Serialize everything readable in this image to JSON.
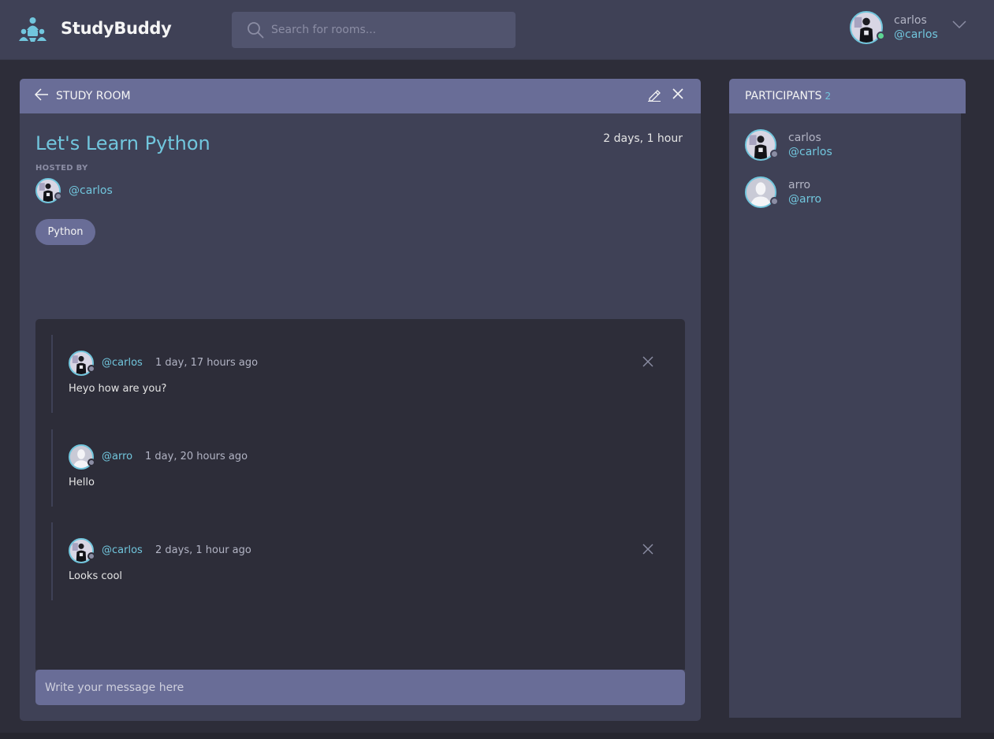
{
  "app": {
    "name": "StudyBuddy"
  },
  "search": {
    "placeholder": "Search for rooms..."
  },
  "current_user": {
    "name": "carlos",
    "handle": "@carlos",
    "status": "online"
  },
  "room": {
    "header_label": "STUDY ROOM",
    "title": "Let's Learn Python",
    "created_ago": "2 days, 1 hour",
    "hosted_by_label": "HOSTED BY",
    "host_handle": "@carlos",
    "topic": "Python"
  },
  "messages": [
    {
      "handle": "@carlos",
      "time": "1 day, 17 hours ago",
      "body": "Heyo how are you?",
      "deletable": true
    },
    {
      "handle": "@arro",
      "time": "1 day, 20 hours ago",
      "body": "Hello",
      "deletable": false
    },
    {
      "handle": "@carlos",
      "time": "2 days, 1 hour ago",
      "body": "Looks cool",
      "deletable": true
    }
  ],
  "message_form": {
    "placeholder": "Write your message here"
  },
  "participants": {
    "label": "PARTICIPANTS",
    "count": "2",
    "items": [
      {
        "name": "carlos",
        "handle": "@carlos"
      },
      {
        "name": "arro",
        "handle": "@arro"
      }
    ]
  },
  "colors": {
    "accent": "#71c6dd",
    "header_bar": "#696d97",
    "panel": "#3f4156",
    "background": "#2d2d39",
    "online": "#5dd693",
    "offline": "#8b8da4"
  },
  "icons": [
    "logo-icon",
    "search-icon",
    "chevron-down-icon",
    "back-arrow-icon",
    "edit-icon",
    "close-icon",
    "delete-icon"
  ]
}
